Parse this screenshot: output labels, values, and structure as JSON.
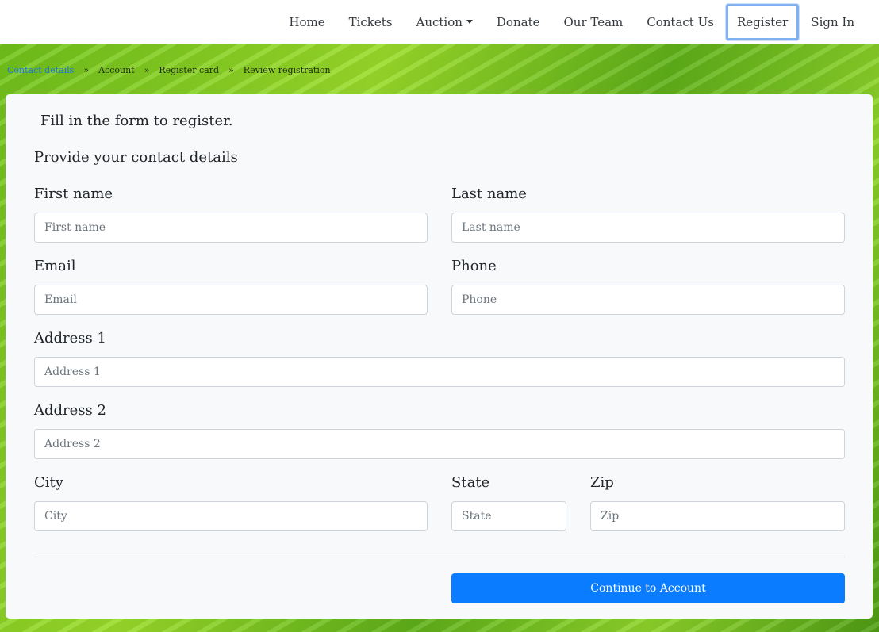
{
  "nav": {
    "items": [
      {
        "label": "Home"
      },
      {
        "label": "Tickets"
      },
      {
        "label": "Auction"
      },
      {
        "label": "Donate"
      },
      {
        "label": "Our Team"
      },
      {
        "label": "Contact Us"
      },
      {
        "label": "Register"
      },
      {
        "label": "Sign In"
      }
    ],
    "active": "Register"
  },
  "breadcrumb": {
    "items": [
      "Contact details",
      "Account",
      "Register card",
      "Review registration"
    ],
    "separator": "»"
  },
  "form": {
    "intro": "Fill in the form to register.",
    "section_title": "Provide your contact details",
    "fields": {
      "first_name": {
        "label": "First name",
        "placeholder": "First name",
        "value": ""
      },
      "last_name": {
        "label": "Last name",
        "placeholder": "Last name",
        "value": ""
      },
      "email": {
        "label": "Email",
        "placeholder": "Email",
        "value": ""
      },
      "phone": {
        "label": "Phone",
        "placeholder": "Phone",
        "value": ""
      },
      "address1": {
        "label": "Address 1",
        "placeholder": "Address 1",
        "value": ""
      },
      "address2": {
        "label": "Address 2",
        "placeholder": "Address 2",
        "value": ""
      },
      "city": {
        "label": "City",
        "placeholder": "City",
        "value": ""
      },
      "state": {
        "label": "State",
        "placeholder": "State",
        "value": ""
      },
      "zip": {
        "label": "Zip",
        "placeholder": "Zip",
        "value": ""
      }
    },
    "submit_label": "Continue to Account"
  },
  "colors": {
    "primary": "#0a7cff",
    "active_outline": "#7fb0f0",
    "link": "#1a73e8"
  }
}
